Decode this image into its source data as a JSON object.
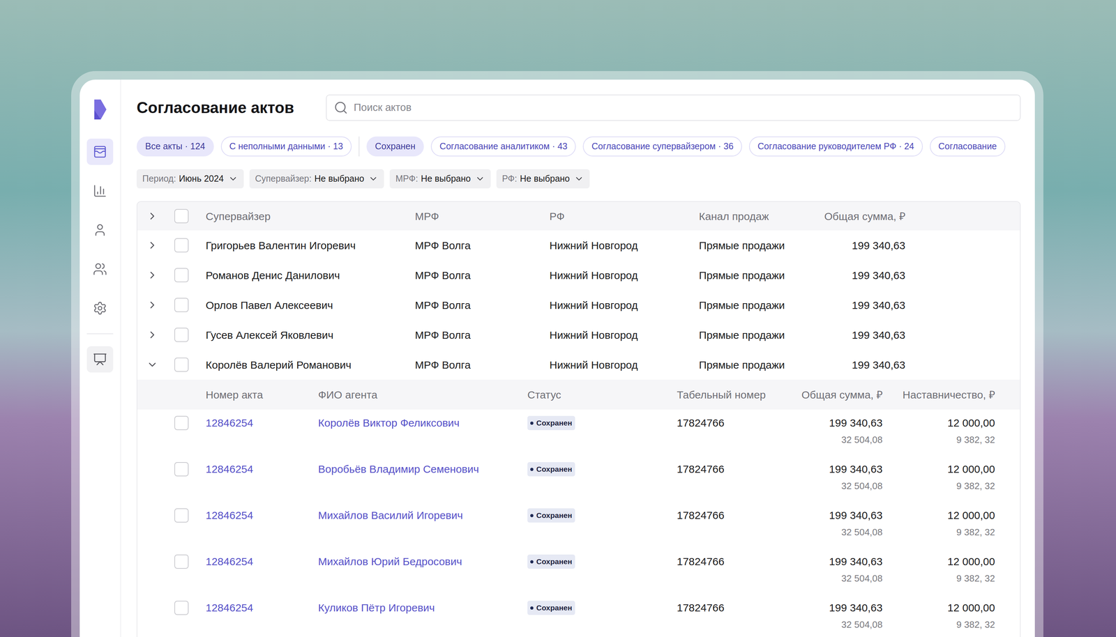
{
  "window": {
    "title": "Согласование актов"
  },
  "search": {
    "placeholder": "Поиск актов"
  },
  "sidebar": {
    "items": [
      {
        "name": "acts",
        "selected": true
      },
      {
        "name": "reports",
        "selected": false
      },
      {
        "name": "profile",
        "selected": false
      },
      {
        "name": "agents",
        "selected": false
      },
      {
        "name": "settings",
        "selected": false
      }
    ],
    "bottom_items": [
      {
        "name": "presentation",
        "selected": false
      }
    ]
  },
  "quick_filters": [
    {
      "label": "Все акты · 124",
      "selected": true
    },
    {
      "label": "С неполными данными · 13",
      "selected": false
    }
  ],
  "status_filters": [
    {
      "label": "Сохранен",
      "selected": true
    },
    {
      "label": "Согласование аналитиком · 43",
      "selected": false
    },
    {
      "label": "Согласование супервайзером · 36",
      "selected": false
    },
    {
      "label": "Согласование руководителем РФ · 24",
      "selected": false
    },
    {
      "label": "Согласование",
      "selected": false
    }
  ],
  "filters": [
    {
      "label": "Период:",
      "value": "Июнь 2024"
    },
    {
      "label": "Супервайзер:",
      "value": "Не выбрано"
    },
    {
      "label": "МРФ:",
      "value": "Не выбрано"
    },
    {
      "label": "РФ:",
      "value": "Не выбрано"
    }
  ],
  "table": {
    "header_checked": false,
    "header_expanded": false,
    "columns": [
      "Супервайзер",
      "МРФ",
      "РФ",
      "Канал продаж",
      "Общая сумма, ₽"
    ],
    "rows": [
      {
        "supervisor": "Григорьев Валентин Игоревич",
        "mrf": "МРФ Волга",
        "rf": "Нижний Новгород",
        "channel": "Прямые продажи",
        "total": "199 340,63",
        "checked": false,
        "expanded": false
      },
      {
        "supervisor": "Романов Денис Данилович",
        "mrf": "МРФ Волга",
        "rf": "Нижний Новгород",
        "channel": "Прямые продажи",
        "total": "199 340,63",
        "checked": false,
        "expanded": false
      },
      {
        "supervisor": "Орлов Павел Алексеевич",
        "mrf": "МРФ Волга",
        "rf": "Нижний Новгород",
        "channel": "Прямые продажи",
        "total": "199 340,63",
        "checked": false,
        "expanded": false
      },
      {
        "supervisor": "Гусев Алексей Яковлевич",
        "mrf": "МРФ Волга",
        "rf": "Нижний Новгород",
        "channel": "Прямые продажи",
        "total": "199 340,63",
        "checked": false,
        "expanded": false
      },
      {
        "supervisor": "Королёв Валерий Романович",
        "mrf": "МРФ Волга",
        "rf": "Нижний Новгород",
        "channel": "Прямые продажи",
        "total": "199 340,63",
        "checked": false,
        "expanded": true
      }
    ],
    "sub_columns": [
      "Номер акта",
      "ФИО агента",
      "Статус",
      "Табельный номер",
      "Общая сумма, ₽",
      "Наставничество, ₽"
    ],
    "sub_rows": [
      {
        "act": "12846254",
        "agent": "Королёв Виктор Феликсович",
        "status": "Сохранен",
        "tab_number": "17824766",
        "total": "199 340,63",
        "total_sub": "32 504,08",
        "mentoring": "12 000,00",
        "mentoring_sub": "9 382, 32",
        "checked": false
      },
      {
        "act": "12846254",
        "agent": "Воробьёв Владимир Семенович",
        "status": "Сохранен",
        "tab_number": "17824766",
        "total": "199 340,63",
        "total_sub": "32 504,08",
        "mentoring": "12 000,00",
        "mentoring_sub": "9 382, 32",
        "checked": false
      },
      {
        "act": "12846254",
        "agent": "Михайлов Василий Игоревич",
        "status": "Сохранен",
        "tab_number": "17824766",
        "total": "199 340,63",
        "total_sub": "32 504,08",
        "mentoring": "12 000,00",
        "mentoring_sub": "9 382, 32",
        "checked": false
      },
      {
        "act": "12846254",
        "agent": "Михайлов Юрий Бедросович",
        "status": "Сохранен",
        "tab_number": "17824766",
        "total": "199 340,63",
        "total_sub": "32 504,08",
        "mentoring": "12 000,00",
        "mentoring_sub": "9 382, 32",
        "checked": false
      },
      {
        "act": "12846254",
        "agent": "Куликов Пётр Игоревич",
        "status": "Сохранен",
        "tab_number": "17824766",
        "total": "199 340,63",
        "total_sub": "32 504,08",
        "mentoring": "12 000,00",
        "mentoring_sub": "9 382, 32",
        "checked": false
      }
    ]
  }
}
